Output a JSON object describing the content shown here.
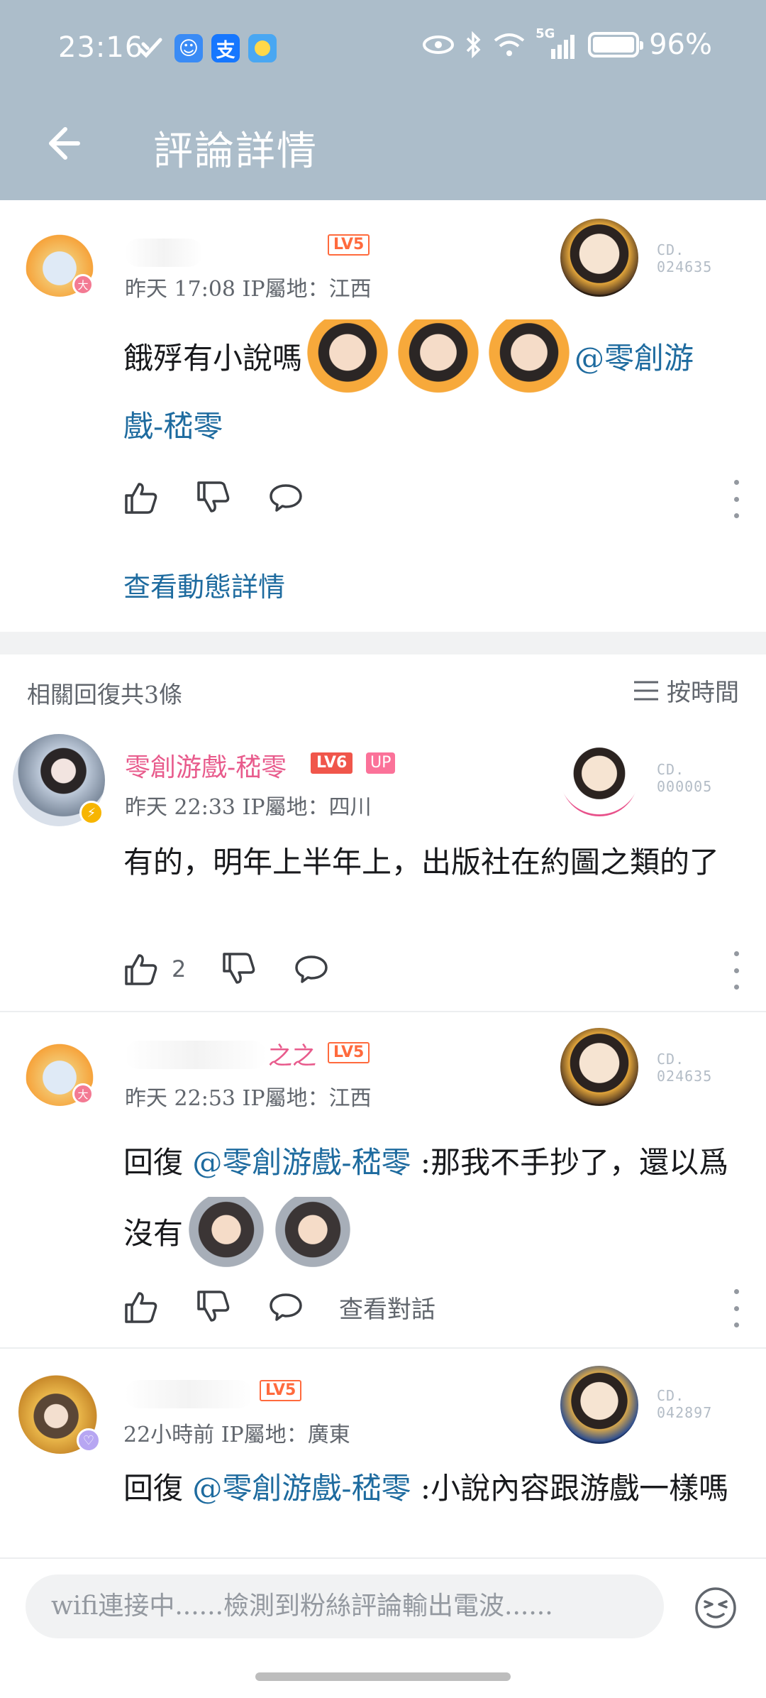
{
  "status_bar": {
    "time": "23:16",
    "network": "5G",
    "battery": "96%"
  },
  "header": {
    "title": "評論詳情"
  },
  "main_comment": {
    "level": "LV5",
    "meta": "昨天 17:08 IP屬地：江西",
    "medal_id": "CD.\n024635",
    "text": "餓殍有小說嗎",
    "mention": "@零創游戲-嵇零",
    "view_dynamic": "查看動態詳情"
  },
  "replies": {
    "header": "相關回復共3條",
    "sort_label": "按時間",
    "items": [
      {
        "username": "零創游戲-嵇零",
        "level": "LV6",
        "up_badge": "UP",
        "meta": "昨天 22:33 IP屬地：四川",
        "medal_id": "CD.\n000005",
        "text": "有的，明年上半年上，出版社在約圖之類的了",
        "likes": "2"
      },
      {
        "username": "之之",
        "level": "LV5",
        "meta": "昨天 22:53 IP屬地：江西",
        "medal_id": "CD.\n024635",
        "reply_prefix": "回復 ",
        "mention": "@零創游戲-嵇零",
        "text": " :那我不手抄了，還以爲沒有",
        "view_conversation": "查看對話"
      },
      {
        "level": "LV5",
        "meta": "22小時前 IP屬地：廣東",
        "medal_id": "CD.\n042897",
        "reply_prefix": "回復 ",
        "mention": "@零創游戲-嵇零",
        "text": " :小說內容跟游戲一樣嗎"
      }
    ]
  },
  "input": {
    "placeholder": "wifi連接中......檢測到粉絲評論輸出電波......"
  },
  "colors": {
    "header_bg": "#acbdca",
    "mention": "#1e6b9f",
    "up_name": "#e85b8c",
    "level": "#ff6a3d"
  }
}
